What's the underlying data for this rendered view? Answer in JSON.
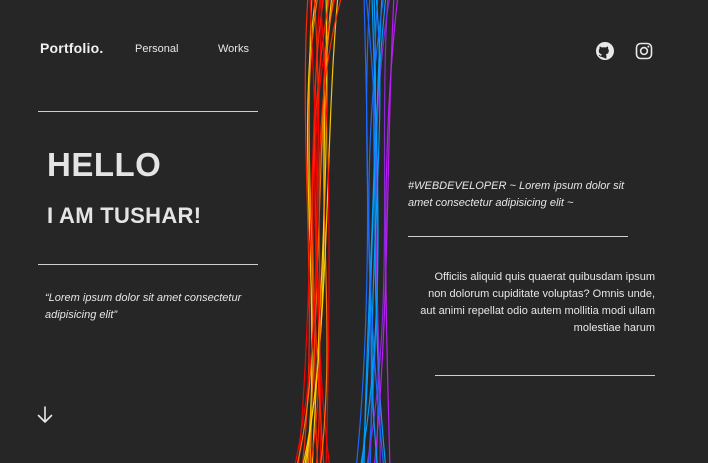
{
  "nav": {
    "brand": "Portfolio.",
    "links": [
      "Personal",
      "Works"
    ]
  },
  "social": {
    "icons": [
      "github-icon",
      "instagram-icon"
    ]
  },
  "hero": {
    "greeting": "HELLO",
    "intro": "I AM TUSHAR!",
    "quote": "“Lorem ipsum dolor sit amet consectetur adipisicing elit”"
  },
  "right": {
    "tagline": "#WEBDEVELOPER ~ Lorem ipsum dolor sit amet consectetur adipisicing elit ~",
    "paragraph": "Officiis aliquid quis quaerat quibusdam ipsum non dolorum cupiditate voluptas? Omnis unde, aut animi repellat odio autem mollitia modi ullam molestiae harum"
  },
  "colors": {
    "background": "#262626",
    "text": "#e6e6e6",
    "line_palette": [
      "#ff2a00",
      "#ff7a00",
      "#ffd000",
      "#ff0000",
      "#1e6bff",
      "#00a2ff",
      "#8a2be2",
      "#c21bff"
    ]
  }
}
